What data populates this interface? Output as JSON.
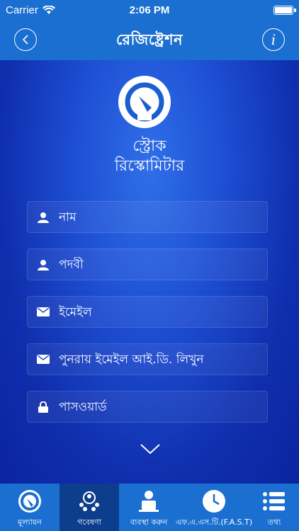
{
  "status_bar": {
    "carrier": "Carrier",
    "time": "2:06 PM"
  },
  "nav": {
    "title": "রেজিষ্ট্রেশন",
    "info_label": "i"
  },
  "logo": {
    "line1": "স্ট্রোক",
    "line2": "রিস্কোমিটার"
  },
  "form": {
    "name_placeholder": "নাম",
    "designation_placeholder": "পদবী",
    "email_placeholder": "ইমেইল",
    "confirm_email_placeholder": "পুনরায় ইমেইল আই.ডি. লিখুন",
    "password_placeholder": "পাসওয়ার্ড"
  },
  "tabs": [
    {
      "label": "মূল্যায়ন",
      "icon": "gauge-icon"
    },
    {
      "label": "গবেষণা",
      "icon": "research-icon"
    },
    {
      "label": "ব্যবস্থা করুন",
      "icon": "manage-icon"
    },
    {
      "label": "এফ.এ.এস.টি.(F.A.S.T)",
      "icon": "clock-icon"
    },
    {
      "label": "তথ্য",
      "icon": "list-icon"
    }
  ],
  "colors": {
    "bar": "#1a6fd0",
    "active_tab": "#0d3e8e",
    "background": "#1e4fd4"
  }
}
